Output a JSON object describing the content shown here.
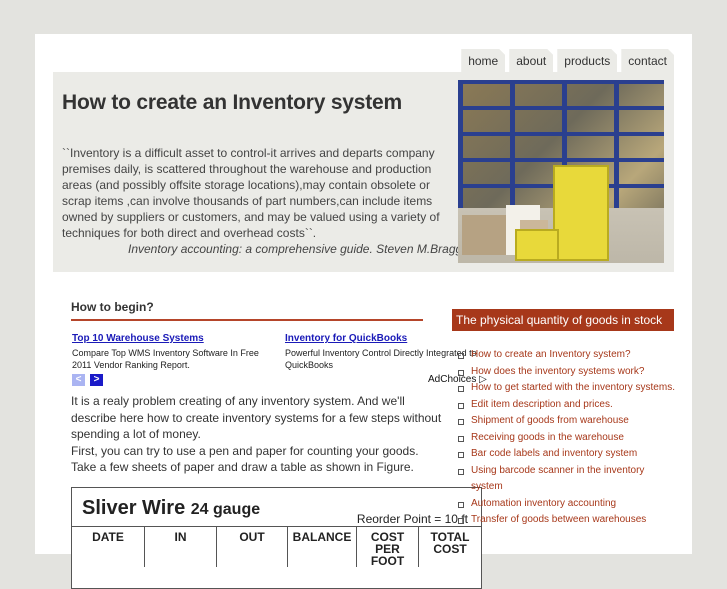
{
  "nav": {
    "tabs": [
      {
        "label": "home"
      },
      {
        "label": "about"
      },
      {
        "label": "products"
      },
      {
        "label": "contact"
      }
    ]
  },
  "header": {
    "title": "How to create an Inventory system",
    "quote": "``Inventory is a difficult asset to control-it arrives and departs company premises daily, is scattered throughout the warehouse and production areas (and possibly offsite storage locations),may contain obsolete or scrap items ,can involve thousands of part numbers,can include items owned by suppliers or customers, and may be valued using a variety of techniques for both direct and overhead costs``.",
    "citation": "Inventory accounting: a comprehensive guide. Steven M.Bragg",
    "image_alt": "warehouse shelves with forklift"
  },
  "main": {
    "section_heading": "How to begin?",
    "ads": [
      {
        "title": "Top 10 Warehouse Systems",
        "text": "Compare Top WMS Inventory Software In Free 2011 Vendor Ranking Report."
      },
      {
        "title": "Inventory for QuickBooks",
        "text": "Powerful Inventory Control Directly Integrated to QuickBooks"
      }
    ],
    "ad_prev": "<",
    "ad_next": ">",
    "adchoices": "AdChoices ▷",
    "paragraphs": [
      "It is a realy problem creating of any inventory system. And we'll describe here how to create inventory systems for a few steps without spending a lot of money.",
      "First, you can try to use a pen and paper for counting your goods. Take a few sheets of paper and draw a table as shown in Figure."
    ],
    "figure": {
      "title": "Sliver Wire",
      "subtitle": "24 gauge",
      "reorder": "Reorder Point = 10 ft",
      "columns": [
        "DATE",
        "IN",
        "OUT",
        "BALANCE",
        "COST PER FOOT",
        "TOTAL COST"
      ]
    }
  },
  "sidebar": {
    "heading": "The physical quantity of goods in stock",
    "items": [
      {
        "label": "How to create an Inventory system?"
      },
      {
        "label": "How does the inventory systems work?"
      },
      {
        "label": "How to get started with the inventory systems."
      },
      {
        "label": "Edit item description and prices."
      },
      {
        "label": "Shipment of goods from warehouse"
      },
      {
        "label": "Receiving goods in the warehouse"
      },
      {
        "label": "Bar code labels and inventory system"
      },
      {
        "label": "Using barcode scanner in the inventory system"
      },
      {
        "label": "Automation inventory accounting"
      },
      {
        "label": "Transfer of goods between warehouses"
      }
    ]
  }
}
